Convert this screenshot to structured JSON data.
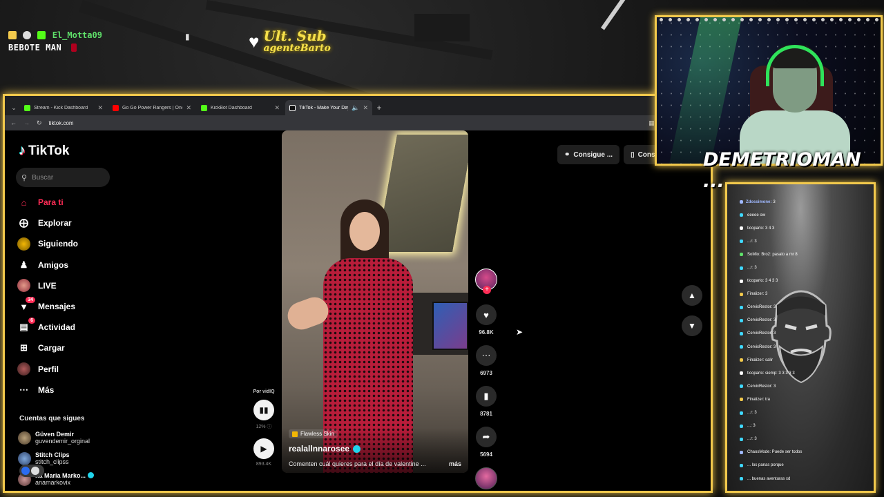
{
  "overlay": {
    "top_user_name": "El_Motta09",
    "top_user_sub": "BEBOTE MAN",
    "last_sub_title": "Ult. Sub",
    "last_sub_user": "agenteBarto"
  },
  "browser": {
    "tabs": [
      {
        "title": "Stream - Kick Dashboard",
        "favicon_color": "#53fc18",
        "active": false
      },
      {
        "title": "Go Go Power Rangers | Once a",
        "favicon_color": "#ff0000",
        "active": false
      },
      {
        "title": "KickBot Dashboard",
        "favicon_color": "#53fc18",
        "active": false
      },
      {
        "title": "TikTok - Make Your Day",
        "favicon_color": "#ffffff",
        "active": true
      }
    ],
    "url": "tiktok.com"
  },
  "tiktok": {
    "logo": "TikTok",
    "search_placeholder": "Buscar",
    "nav": [
      {
        "label": "Para ti",
        "icon": "home-icon",
        "active": true
      },
      {
        "label": "Explorar",
        "icon": "compass-icon"
      },
      {
        "label": "Siguiendo",
        "icon": "following-avatar-icon"
      },
      {
        "label": "Amigos",
        "icon": "friends-icon"
      },
      {
        "label": "LIVE",
        "icon": "live-avatar-icon"
      },
      {
        "label": "Mensajes",
        "icon": "messages-icon",
        "badge": "34"
      },
      {
        "label": "Actividad",
        "icon": "activity-icon",
        "badge": "6"
      },
      {
        "label": "Cargar",
        "icon": "upload-icon"
      },
      {
        "label": "Perfil",
        "icon": "profile-avatar-icon"
      },
      {
        "label": "Más",
        "icon": "more-icon"
      }
    ],
    "following_title": "Cuentas que sigues",
    "following": [
      {
        "name": "Güven Demir",
        "handle": "guvendemir_orginal",
        "verified": false
      },
      {
        "name": "Stitch Clips",
        "handle": "stitch_clipss",
        "verified": false
      },
      {
        "name": "na Maria Marko...",
        "handle": "anamarkovix",
        "verified": true
      }
    ],
    "vidiq": {
      "label": "Por vidIQ",
      "percent": "12%",
      "views": "893.4K"
    },
    "video": {
      "effect": "Flawless Skin",
      "author": "realallnnarosee",
      "caption": "Comenten cuál quieres para el día de valentine ...",
      "more": "más"
    },
    "actions": {
      "likes": "96.8K",
      "comments": "6973",
      "saves": "8781",
      "shares": "5694"
    },
    "pills": [
      "Consigue ...",
      "Consegui"
    ]
  },
  "webcam": {
    "streamer_name": "DEMETRIOMAN ..."
  },
  "chat": {
    "messages": [
      {
        "user": "Zdossimone:",
        "text": "3",
        "color": "#9fb8ff"
      },
      {
        "user": "",
        "text": "eeeee ow",
        "color": "#3fd8ff"
      },
      {
        "user": "",
        "text": "ticoparlo: 3 4 3",
        "color": "#fff"
      },
      {
        "user": "",
        "text": "...r: 3",
        "color": "#3fd8ff"
      },
      {
        "user": "",
        "text": "SoMio: Bro2: pasalo a mr 8",
        "color": "#5fe06a"
      },
      {
        "user": "",
        "text": "...r: 3",
        "color": "#3fd8ff"
      },
      {
        "user": "",
        "text": "ticoparlo: 3 4 3 3",
        "color": "#fff"
      },
      {
        "user": "",
        "text": "Finalizer: 3",
        "color": "#f2c94c"
      },
      {
        "user": "",
        "text": "CervixRestor: 3",
        "color": "#3fd8ff"
      },
      {
        "user": "",
        "text": "CervixRestor: 3",
        "color": "#3fd8ff"
      },
      {
        "user": "",
        "text": "CervixRestor: 3",
        "color": "#3fd8ff"
      },
      {
        "user": "",
        "text": "CervixRestor: 3",
        "color": "#3fd8ff"
      },
      {
        "user": "",
        "text": "Finalizer: salir",
        "color": "#f2c94c"
      },
      {
        "user": "",
        "text": "ticoparlo: siemp: 3 3 3 3 3",
        "color": "#fff"
      },
      {
        "user": "",
        "text": "CervixRestor: 3",
        "color": "#3fd8ff"
      },
      {
        "user": "",
        "text": "Finalizer: tra",
        "color": "#f2c94c"
      },
      {
        "user": "",
        "text": "...r: 3",
        "color": "#3fd8ff"
      },
      {
        "user": "",
        "text": "...: 3",
        "color": "#3fd8ff"
      },
      {
        "user": "",
        "text": "...r: 3",
        "color": "#3fd8ff"
      },
      {
        "user": "",
        "text": "ChaosMode: Puede ser todos",
        "color": "#9fb8ff"
      },
      {
        "user": "",
        "text": "... los panas porque",
        "color": "#3fd8ff"
      },
      {
        "user": "",
        "text": "... buenas aventuras xd",
        "color": "#3fd8ff"
      }
    ]
  }
}
